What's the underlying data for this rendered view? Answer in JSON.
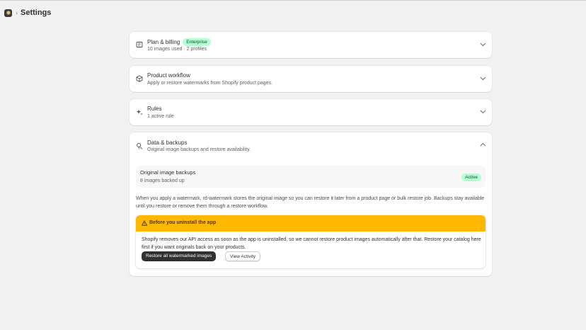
{
  "header": {
    "breadcrumb_separator": "›",
    "title": "Settings",
    "logo_icon": "app-logo-icon"
  },
  "sections": {
    "plan": {
      "title": "Plan & billing",
      "badge": "Enterprise",
      "subtitle": "10 images used · 2 profiles",
      "icon": "receipt-icon"
    },
    "workflow": {
      "title": "Product workflow",
      "subtitle": "Apply or restore watermarks from Shopify product pages.",
      "icon": "package-icon"
    },
    "rules": {
      "title": "Rules",
      "subtitle": "1 active rule",
      "icon": "sparkle-icon"
    },
    "backups": {
      "title": "Data & backups",
      "subtitle": "Original image backups and restore availability.",
      "icon": "database-search-icon",
      "status_box": {
        "title": "Original image backups",
        "subtitle": "8 images backed up",
        "badge": "Active"
      },
      "description": "When you apply a watermark, rd-watermark stores the original image so you can restore it later from a product page or bulk restore job. Backups stay available until you restore or remove them through a restore workflow.",
      "warning": {
        "title": "Before you uninstall the app",
        "body": "Shopify removes our API access as soon as the app is uninstalled, so we cannot restore product images automatically after that. Restore your catalog here first if you want originals back on your products.",
        "primary_button": "Restore all watermarked images",
        "secondary_button": "View Activity",
        "icon": "warning-triangle-icon"
      }
    }
  },
  "colors": {
    "background": "#f1f1f1",
    "success_badge": "#b4fed2",
    "warning_banner": "#ffb800",
    "primary_button": "#303030"
  }
}
